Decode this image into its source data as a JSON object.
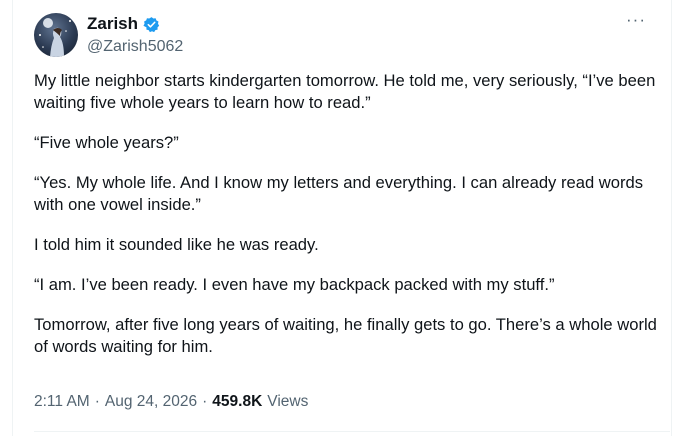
{
  "author": {
    "name": "Zarish",
    "handle": "@Zarish5062"
  },
  "more_label": "···",
  "tweet": {
    "paragraphs": [
      "My little neighbor starts kindergarten tomorrow. He told me, very seriously, “I’ve been waiting five whole years to learn how to read.”",
      "“Five whole years?”",
      "“Yes. My whole life. And I know my letters and everything. I can already read words with one vowel inside.”",
      "I told him it sounded like he was ready.",
      "“I am. I’ve been ready. I even have my backpack packed with my stuff.”",
      "Tomorrow, after five long years of waiting, he finally gets to go. There’s a whole world of words waiting for him."
    ]
  },
  "meta": {
    "time": "2:11 AM",
    "sep1": "·",
    "date": "Aug 24, 2026",
    "sep2": "·",
    "views_count": "459.8K",
    "views_label": "Views"
  },
  "colors": {
    "verified": "#1d9bf0",
    "muted": "#536471",
    "text": "#0f1419"
  }
}
